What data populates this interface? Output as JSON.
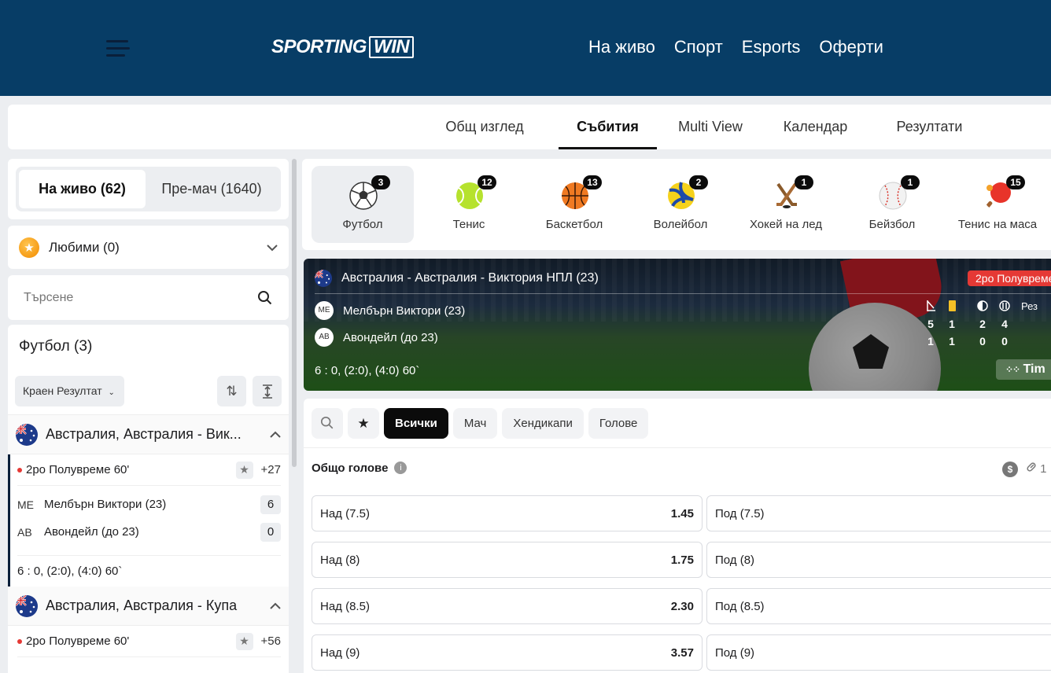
{
  "header": {
    "logo_part1": "SPORTING",
    "logo_part2": "WIN",
    "nav": [
      "На живо",
      "Спорт",
      "Esports",
      "Оферти"
    ]
  },
  "subnav": {
    "tabs": [
      "Общ изглед",
      "Събития",
      "Multi View",
      "Календар",
      "Резултати"
    ],
    "active": "Събития"
  },
  "sidebar": {
    "segment": {
      "live": "На живо (62)",
      "prematch": "Пре-мач (1640)"
    },
    "favorites": "Любими (0)",
    "search_placeholder": "Търсене",
    "sport_title": "Футбол (3)",
    "market_filter": "Краен Резултат",
    "leagues": [
      {
        "name": "Австралия, Австралия - Вик...",
        "status": "2ро Полувреме 60'",
        "more": "+27",
        "home": {
          "abbr": "ME",
          "name": "Мелбърн Виктори (23)",
          "score": "6"
        },
        "away": {
          "abbr": "AB",
          "name": "Авондейл (до 23)",
          "score": "0"
        },
        "summary": "6 : 0, (2:0), (4:0) 60`"
      },
      {
        "name": "Австралия, Австралия - Купа",
        "status": "2ро Полувреме 60'",
        "more": "+56"
      }
    ]
  },
  "sports": [
    {
      "label": "Футбол",
      "count": "3",
      "icon": "soccer-ball-icon"
    },
    {
      "label": "Тенис",
      "count": "12",
      "icon": "tennis-ball-icon"
    },
    {
      "label": "Баскетбол",
      "count": "13",
      "icon": "basketball-icon"
    },
    {
      "label": "Волейбол",
      "count": "2",
      "icon": "volleyball-icon"
    },
    {
      "label": "Хокей на лед",
      "count": "1",
      "icon": "hockey-sticks-icon"
    },
    {
      "label": "Бейзбол",
      "count": "1",
      "icon": "baseball-icon"
    },
    {
      "label": "Тенис на маса",
      "count": "15",
      "icon": "table-tennis-icon"
    }
  ],
  "event": {
    "league": "Австралия - Австралия - Виктория НПЛ (23)",
    "badge": "2ро Полувреме",
    "home": {
      "abbr": "ME",
      "name": "Мелбърн Виктори (23)"
    },
    "away": {
      "abbr": "AB",
      "name": "Авондейл (до 23)"
    },
    "stats_home": [
      "5",
      "1",
      "2",
      "4"
    ],
    "stats_away": [
      "1",
      "1",
      "0",
      "0"
    ],
    "stat_extra": "Рез",
    "summary": "6 : 0, (2:0), (4:0) 60`",
    "timeline_label": "Tim"
  },
  "markets": {
    "tabs": [
      "Всички",
      "Мач",
      "Хендикапи",
      "Голове"
    ],
    "active": "Всички",
    "title": "Общо голове",
    "info_glyph": "i",
    "dollar_glyph": "$",
    "link_count": "1",
    "rows": [
      {
        "over": "Над (7.5)",
        "over_odd": "1.45",
        "under": "Под (7.5)"
      },
      {
        "over": "Над (8)",
        "over_odd": "1.75",
        "under": "Под (8)"
      },
      {
        "over": "Над (8.5)",
        "over_odd": "2.30",
        "under": "Под (8.5)"
      },
      {
        "over": "Над (9)",
        "over_odd": "3.57",
        "under": "Под (9)"
      }
    ]
  },
  "colors": {
    "header_bg": "#073d66",
    "live_dot": "#e53935",
    "active_tab": "#0b0b0b"
  }
}
